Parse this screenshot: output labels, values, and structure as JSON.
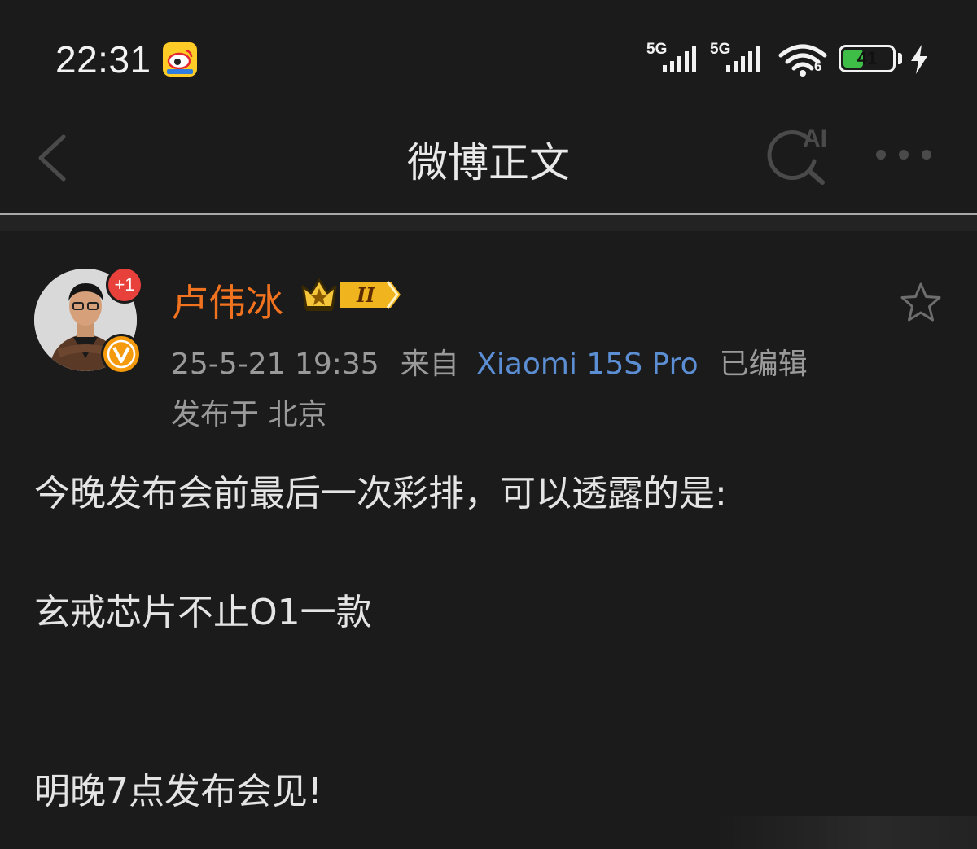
{
  "status_bar": {
    "time": "22:31",
    "notification_app_icon": "weibo-icon",
    "sim1_label": "5G",
    "sim2_label": "5G",
    "wifi_label": "6",
    "battery_level": "41",
    "battery_fraction": 0.41,
    "charging_icon": "lightning-icon"
  },
  "nav": {
    "back_icon": "chevron-left-icon",
    "title": "微博正文",
    "ai_search_icon": "ai-search-icon",
    "more_icon": "more-dots-icon"
  },
  "post": {
    "author": {
      "name": "卢伟冰",
      "avatar_icon": "avatar",
      "badge_plus": "+1",
      "verified_icon": "verified-v-icon",
      "membership_badge": "crown-badge",
      "membership_level": "II"
    },
    "timestamp": "25-5-21 19:35",
    "source_prefix": "来自",
    "source_device": "Xiaomi 15S Pro",
    "edited_label": "已编辑",
    "location": "发布于 北京",
    "favorite_icon": "star-outline-icon",
    "lines": [
      "今晚发布会前最后一次彩排，可以透露的是:",
      "玄戒芯片不止O1一款",
      "明晚7点发布会见!"
    ]
  },
  "colors": {
    "background": "#1b1b1b",
    "author_name": "#f1731f",
    "device_link": "#5c8ed4",
    "meta_text": "#9a9a9a",
    "body_text": "#e4e4e4",
    "battery_green": "#3fbe47"
  }
}
